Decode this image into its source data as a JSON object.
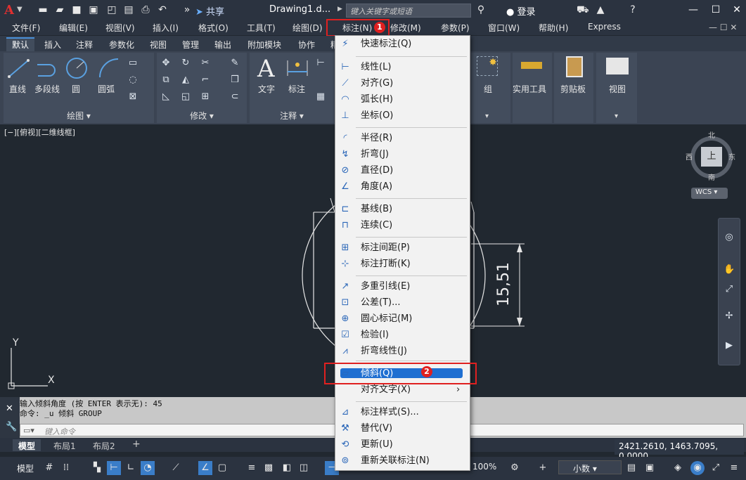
{
  "titlebar": {
    "share_label": "共享",
    "doc_title": "Drawing1.d...",
    "search_placeholder": "键入关键字或短语",
    "login_label": "登录"
  },
  "menubar": {
    "items": [
      "文件(F)",
      "编辑(E)",
      "视图(V)",
      "插入(I)",
      "格式(O)",
      "工具(T)",
      "绘图(D)",
      "标注(N)",
      "修改(M)",
      "参数(P)",
      "窗口(W)",
      "帮助(H)",
      "Express"
    ]
  },
  "badges": {
    "step1": "1",
    "step2": "2"
  },
  "ribbon_tabs": [
    "默认",
    "插入",
    "注释",
    "参数化",
    "视图",
    "管理",
    "输出",
    "附加模块",
    "协作",
    "精"
  ],
  "ribbon": {
    "draw_tools": [
      "直线",
      "多段线",
      "圆",
      "圆弧"
    ],
    "draw_panel": "绘图",
    "modify_panel": "修改",
    "annot_tools": [
      "文字",
      "标注"
    ],
    "annot_panel": "注释",
    "right_tools": [
      "组",
      "实用工具",
      "剪贴板",
      "视图"
    ]
  },
  "drawing": {
    "view_label": "[−][俯视][二维线框]",
    "dimension_text": "15,51",
    "axis_y": "Y",
    "axis_x": "X"
  },
  "viewcube": {
    "north": "北",
    "south": "南",
    "east": "东",
    "west": "西",
    "top": "上",
    "wcs": "WCS"
  },
  "command": {
    "line1": "输入倾斜角度 (按 ENTER 表示无): 45",
    "line2": "命令: _u 倾斜 GROUP",
    "input_placeholder": "键入命令"
  },
  "layout_tabs": [
    "模型",
    "布局1",
    "布局2"
  ],
  "coords": "2421.2610, 1463.7095, 0.0000",
  "statusbar": {
    "model_label": "模型",
    "zoom": "100%",
    "units": "小数"
  },
  "dim_menu": {
    "items": [
      {
        "label": "快速标注(Q)",
        "icon": "quick-dim-icon"
      },
      {
        "label": "线性(L)",
        "icon": "linear-icon"
      },
      {
        "label": "对齐(G)",
        "icon": "aligned-icon"
      },
      {
        "label": "弧长(H)",
        "icon": "arc-length-icon"
      },
      {
        "label": "坐标(O)",
        "icon": "ordinate-icon"
      },
      {
        "label": "半径(R)",
        "icon": "radius-icon"
      },
      {
        "label": "折弯(J)",
        "icon": "jogged-icon"
      },
      {
        "label": "直径(D)",
        "icon": "diameter-icon"
      },
      {
        "label": "角度(A)",
        "icon": "angular-icon"
      },
      {
        "label": "基线(B)",
        "icon": "baseline-icon"
      },
      {
        "label": "连续(C)",
        "icon": "continue-icon"
      },
      {
        "label": "标注间距(P)",
        "icon": "dim-space-icon"
      },
      {
        "label": "标注打断(K)",
        "icon": "dim-break-icon"
      },
      {
        "label": "多重引线(E)",
        "icon": "mleader-icon"
      },
      {
        "label": "公差(T)...",
        "icon": "tolerance-icon"
      },
      {
        "label": "圆心标记(M)",
        "icon": "center-mark-icon"
      },
      {
        "label": "检验(I)",
        "icon": "inspect-icon"
      },
      {
        "label": "折弯线性(J)",
        "icon": "jogged-linear-icon"
      },
      {
        "label": "倾斜(Q)",
        "icon": "oblique-icon"
      },
      {
        "label": "对齐文字(X)",
        "icon": "align-text-icon"
      },
      {
        "label": "标注样式(S)...",
        "icon": "dim-style-icon"
      },
      {
        "label": "替代(V)",
        "icon": "override-icon"
      },
      {
        "label": "更新(U)",
        "icon": "update-icon"
      },
      {
        "label": "重新关联标注(N)",
        "icon": "reassociate-icon"
      }
    ]
  }
}
